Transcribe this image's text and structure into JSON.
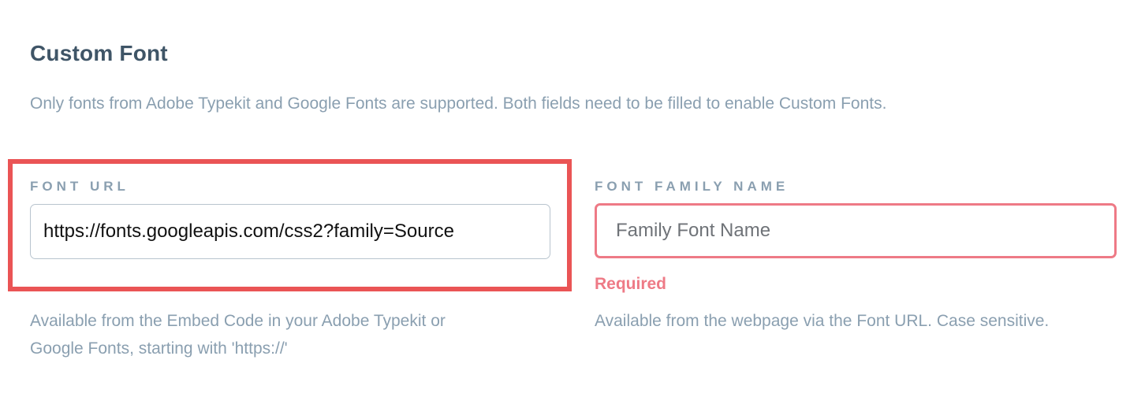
{
  "section": {
    "title": "Custom Font",
    "description": "Only fonts from Adobe Typekit and Google Fonts are supported. Both fields need to be filled to enable Custom Fonts."
  },
  "font_url": {
    "label": "FONT URL",
    "value": "https://fonts.googleapis.com/css2?family=Source",
    "help_line1": "Available from the Embed Code in your Adobe Typekit or",
    "help_line2": "Google Fonts, starting with 'https://'"
  },
  "font_family": {
    "label": "FONT FAMILY NAME",
    "value": "",
    "placeholder": "Family Font Name",
    "error": "Required",
    "help": "Available from the webpage via the Font URL. Case sensitive."
  },
  "colors": {
    "highlight": "#ea5455",
    "error": "#ee7a86",
    "title": "#3f5567",
    "muted": "#8a9fb0"
  }
}
